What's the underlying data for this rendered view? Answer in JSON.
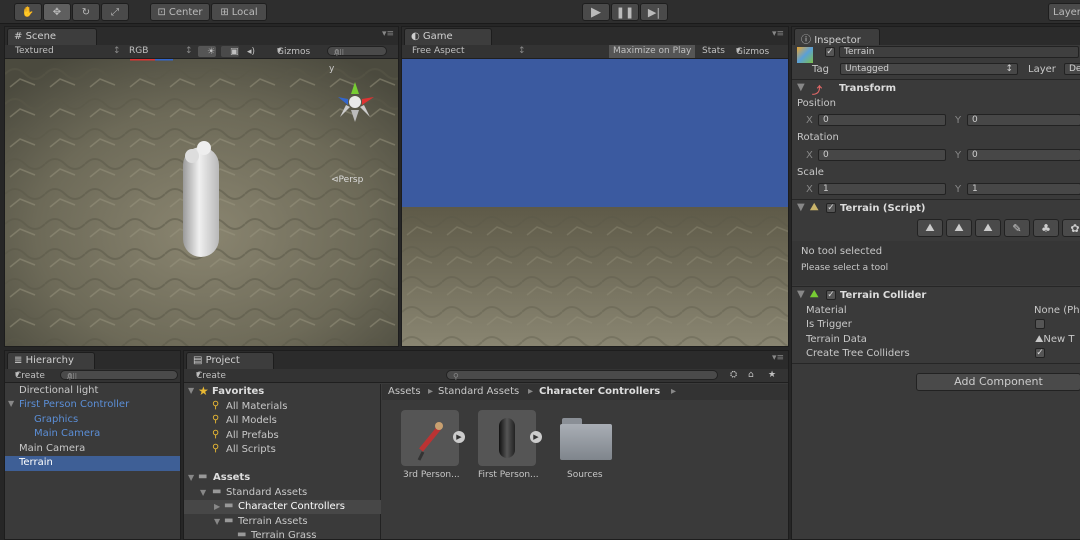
{
  "toolbar": {
    "pivot_label": "Center",
    "space_label": "Local",
    "layers_label": "Layer"
  },
  "scene": {
    "tab_label": "Scene",
    "shading_mode": "Textured",
    "color_mode": "RGB",
    "gizmos_label": "Gizmos",
    "search_placeholder": "All",
    "persp_label": "Persp"
  },
  "game": {
    "tab_label": "Game",
    "aspect": "Free Aspect",
    "maximize_label": "Maximize on Play",
    "stats_label": "Stats",
    "gizmos_label": "Gizmos"
  },
  "hierarchy": {
    "tab_label": "Hierarchy",
    "create_label": "Create",
    "search_placeholder": "All",
    "items": [
      {
        "label": "Directional light"
      },
      {
        "label": "First Person Controller"
      },
      {
        "label": "Graphics"
      },
      {
        "label": "Main Camera"
      },
      {
        "label": "Main Camera"
      },
      {
        "label": "Terrain"
      }
    ]
  },
  "project": {
    "tab_label": "Project",
    "create_label": "Create",
    "favorites_label": "Favorites",
    "favorites": [
      "All Materials",
      "All Models",
      "All Prefabs",
      "All Scripts"
    ],
    "assets_label": "Assets",
    "tree": [
      "Standard Assets",
      "Character Controllers",
      "Terrain Assets",
      "Terrain Grass"
    ],
    "breadcrumb": [
      "Assets",
      "Standard Assets",
      "Character Controllers"
    ],
    "thumbnails": [
      "3rd Person...",
      "First Person...",
      "Sources"
    ]
  },
  "inspector": {
    "tab_label": "Inspector",
    "object_name": "Terrain",
    "tag_label": "Tag",
    "tag_value": "Untagged",
    "layer_label": "Layer",
    "layer_value": "De",
    "transform": {
      "title": "Transform",
      "position_label": "Position",
      "rotation_label": "Rotation",
      "scale_label": "Scale",
      "x_label": "X",
      "y_label": "Y",
      "position": {
        "x": "0",
        "y": "0"
      },
      "rotation": {
        "x": "0",
        "y": "0"
      },
      "scale": {
        "x": "1",
        "y": "1"
      }
    },
    "terrain_script": {
      "title": "Terrain (Script)",
      "no_tool": "No tool selected",
      "hint": "Please select a tool"
    },
    "terrain_collider": {
      "title": "Terrain Collider",
      "material_label": "Material",
      "material_value": "None (Ph",
      "is_trigger_label": "Is Trigger",
      "terrain_data_label": "Terrain Data",
      "terrain_data_value": "New T",
      "tree_colliders_label": "Create Tree Colliders"
    },
    "add_component_label": "Add Component"
  },
  "colors": {
    "sky_blue": "#3b5aa0",
    "selection_blue": "#3e5f96",
    "panel_bg": "#3a3a3a"
  }
}
